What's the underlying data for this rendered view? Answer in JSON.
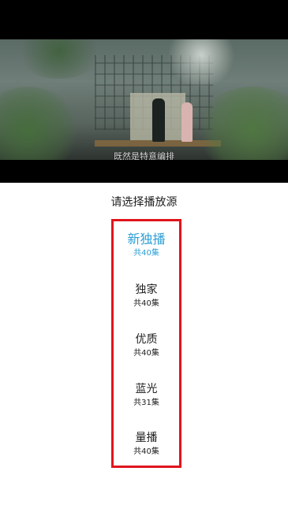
{
  "video": {
    "subtitle": "既然是特意编排"
  },
  "dialog": {
    "title": "请选择播放源",
    "sources": [
      {
        "name": "新独播",
        "count": "共40集",
        "selected": true
      },
      {
        "name": "独家",
        "count": "共40集",
        "selected": false
      },
      {
        "name": "优质",
        "count": "共40集",
        "selected": false
      },
      {
        "name": "蓝光",
        "count": "共31集",
        "selected": false
      },
      {
        "name": "量播",
        "count": "共40集",
        "selected": false
      }
    ]
  },
  "colors": {
    "selected": "#2e9fd6",
    "highlight_border": "#e0141c",
    "text": "#222222"
  }
}
